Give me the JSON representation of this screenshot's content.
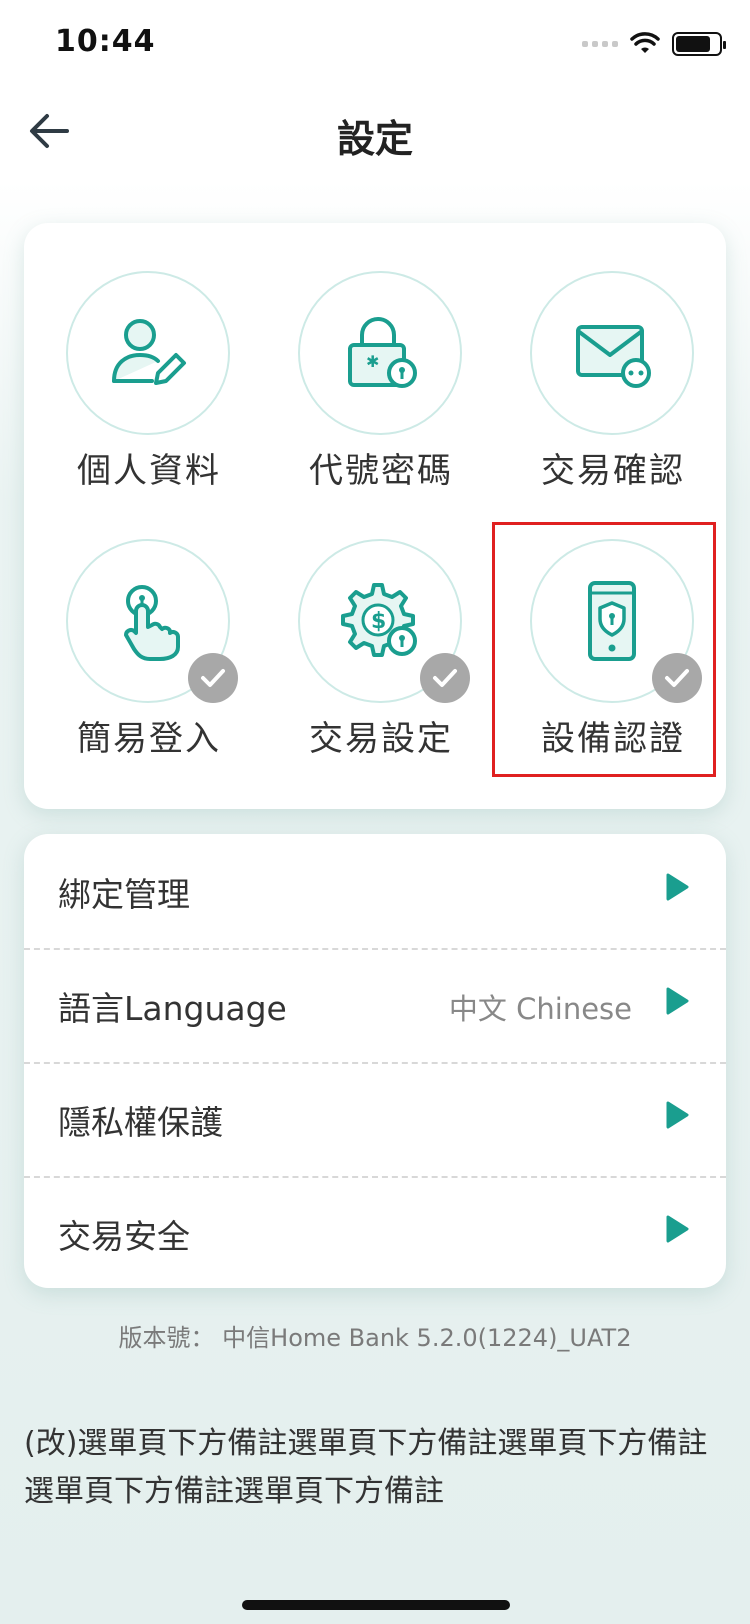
{
  "status_bar": {
    "time": "10:44"
  },
  "header": {
    "title": "設定"
  },
  "tiles": [
    {
      "label": "個人資料",
      "icon": "person-edit-icon",
      "checked": false
    },
    {
      "label": "代號密碼",
      "icon": "lock-icon",
      "checked": false
    },
    {
      "label": "交易確認",
      "icon": "mail-message-icon",
      "checked": false
    },
    {
      "label": "簡易登入",
      "icon": "touch-lock-icon",
      "checked": true
    },
    {
      "label": "交易設定",
      "icon": "gear-dollar-icon",
      "checked": true
    },
    {
      "label": "設備認證",
      "icon": "phone-shield-icon",
      "checked": true
    }
  ],
  "menu": [
    {
      "label": "綁定管理",
      "value": ""
    },
    {
      "label": "語言Language",
      "value": "中文 Chinese"
    },
    {
      "label": "隱私權保護",
      "value": ""
    },
    {
      "label": "交易安全",
      "value": ""
    }
  ],
  "version": "版本號： 中信Home Bank 5.2.0(1224)_UAT2",
  "remark": "(改)選單頁下方備註選單頁下方備註選單頁下方備註選單頁下方備註選單頁下方備註",
  "colors": {
    "accent": "#1a9e8f",
    "highlight_border": "#e02020",
    "check_badge": "#a8a8a8"
  }
}
